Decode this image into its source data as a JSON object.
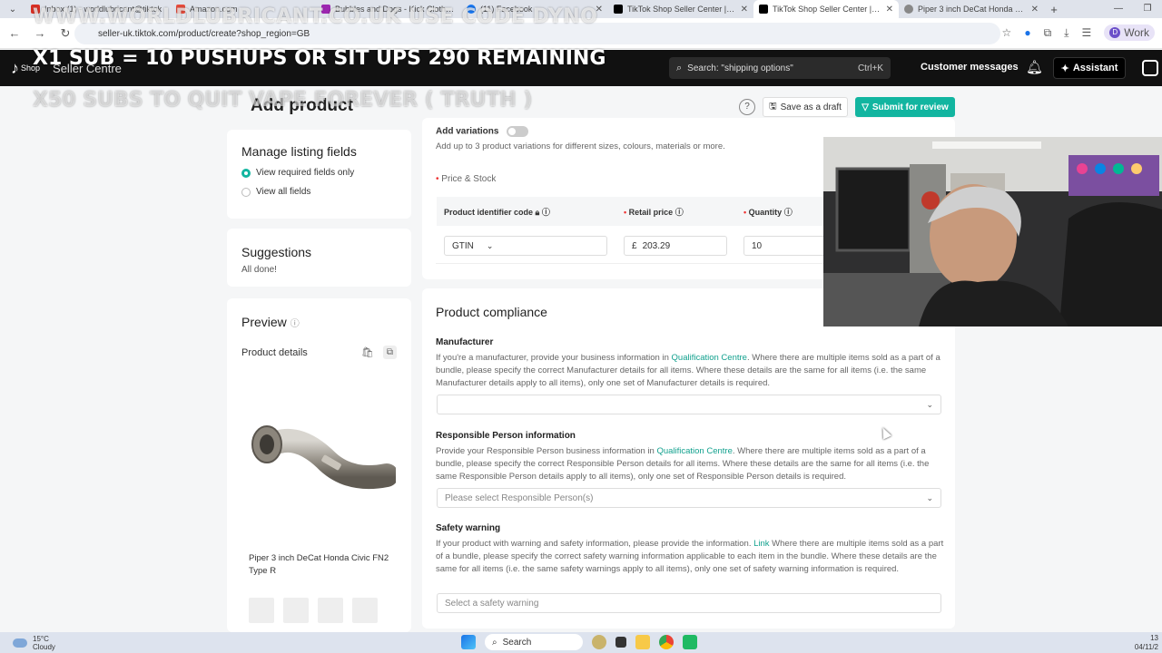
{
  "browser": {
    "tabs": [
      {
        "title": "Inbox (1) - worldlubricant@tiktok",
        "active": false,
        "color": "#d93025"
      },
      {
        "title": "Amazon.com",
        "active": false,
        "color": "#e74c3c"
      },
      {
        "title": "Bubbles and Dogs - Kick Clothing",
        "active": false,
        "color": "#9c27b0"
      },
      {
        "title": "(11) Facebook",
        "active": false,
        "color": "#1877f2"
      },
      {
        "title": "TikTok Shop Seller Center | Uni",
        "active": false,
        "color": "#000000"
      },
      {
        "title": "TikTok Shop Seller Center | Uni",
        "active": true,
        "color": "#000000"
      },
      {
        "title": "Piper 3 inch DeCat Honda Civic",
        "active": false,
        "color": "#888888"
      }
    ],
    "url": "seller-uk.tiktok.com/product/create?shop_region=GB",
    "profile_initial": "D",
    "profile_label": "Work"
  },
  "overlay": {
    "line1": "www.worldlubricant.co.uk use code dyno",
    "line2": "x1 sub = 10 pushups or sit ups 290 remaining",
    "line3": "x50 subs to quit vape forever ( truth )"
  },
  "header": {
    "brand_logo": "TikTok",
    "brand_shop": "Shop",
    "brand_centre": "Seller Centre",
    "search_placeholder": "Search: \"shipping options\"",
    "search_shortcut": "Ctrl+K",
    "customer_messages": "Customer messages",
    "assistant": "Assistant"
  },
  "page": {
    "title": "Add product",
    "save_draft": "Save as a draft",
    "submit": "Submit for review"
  },
  "sidebar": {
    "manage_title": "Manage listing fields",
    "opt_required": "View required fields only",
    "opt_all": "View all fields",
    "suggestions_title": "Suggestions",
    "suggestions_text": "All done!",
    "preview_title": "Preview",
    "product_details": "Product details",
    "product_name": "Piper 3 inch DeCat Honda Civic FN2 Type R"
  },
  "variations": {
    "label": "Add variations",
    "hint": "Add up to 3 product variations for different sizes, colours, materials or more.",
    "price_stock": "Price & Stock",
    "col_identifier": "Product identifier code",
    "col_retail": "Retail price",
    "col_quantity": "Quantity",
    "identifier_value": "GTIN",
    "currency": "£",
    "price_value": "203.29",
    "quantity_value": "10"
  },
  "compliance": {
    "title": "Product compliance",
    "manufacturer_title": "Manufacturer",
    "manufacturer_text_a": "If you're a manufacturer, provide your business information in ",
    "manufacturer_link": "Qualification Centre",
    "manufacturer_text_b": ". Where there are multiple items sold as a part of a bundle, please specify the correct Manufacturer details for all items. Where these details are the same for all items (i.e. the same Manufacturer details apply to all items), only one set of Manufacturer details is required.",
    "rp_title": "Responsible Person information",
    "rp_text_a": "Provide your Responsible Person business information in ",
    "rp_link": "Qualification Centre",
    "rp_text_b": ". Where there are multiple items sold as a part of a bundle, please specify the correct Responsible Person details for all items. Where these details are the same for all items (i.e. the same Responsible Person details apply to all items), only one set of Responsible Person details is required.",
    "rp_placeholder": "Please select Responsible Person(s)",
    "safety_title": "Safety warning",
    "safety_text_a": "If your product with warning and safety information, please provide the information. ",
    "safety_link": "Link",
    "safety_text_b": " Where there are multiple items sold as a part of a bundle, please specify the correct safety warning information applicable to each item in the bundle. Where these details are the same for all items (i.e. the same safety warnings apply to all items), only one set of safety warning information is required.",
    "safety_placeholder": "Select a safety warning"
  },
  "taskbar": {
    "temp": "15°C",
    "condition": "Cloudy",
    "search": "Search",
    "time": "13",
    "date": "04/11/2"
  },
  "colors": {
    "accent": "#12b5a0",
    "header": "#111111"
  }
}
